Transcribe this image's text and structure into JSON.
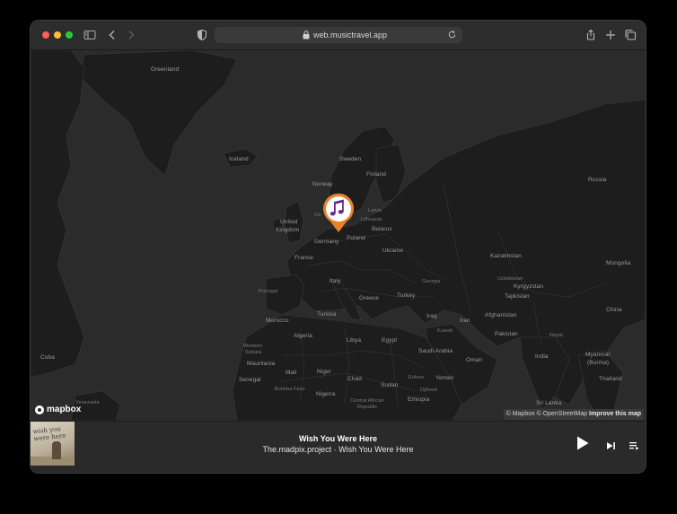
{
  "browser": {
    "url": "web.musictravel.app"
  },
  "map": {
    "countries": {
      "greenland": "Greenland",
      "iceland": "Iceland",
      "sweden": "Sweden",
      "finland": "Finland",
      "norway": "Norway",
      "russia": "Russia",
      "united_kingdom_1": "United",
      "united_kingdom_2": "Kingdom",
      "denmark": "De",
      "latvia": "Latvia",
      "lithuania": "Lithuania",
      "belarus": "Belarus",
      "poland": "Poland",
      "germany": "Germany",
      "ukraine": "Ukraine",
      "kazakhstan": "Kazakhstan",
      "mongolia": "Mongolia",
      "france": "France",
      "italy": "Italy",
      "portugal": "Portugal",
      "greece": "Greece",
      "turkey": "Turkey",
      "georgia": "Georgia",
      "uzbekistan": "Uzbekistan",
      "kyrgyzstan": "Kyrgyzstan",
      "tajikistan": "Tajikistan",
      "china": "China",
      "morocco": "Morocco",
      "tunisia": "Tunisia",
      "iraq": "Iraq",
      "iran": "Iran",
      "afghanistan": "Afghanistan",
      "pakistan": "Pakistan",
      "algeria": "Algeria",
      "libya": "Libya",
      "egypt": "Egypt",
      "kuwait": "Kuwait",
      "saudi_arabia": "Saudi Arabia",
      "nepal": "Nepal",
      "india": "India",
      "myanmar_1": "Myanmar",
      "myanmar_2": "(Burma)",
      "cuba": "Cuba",
      "western_sahara_1": "Western",
      "western_sahara_2": "Sahara",
      "mauritania": "Mauritania",
      "mali": "Mali",
      "niger": "Niger",
      "chad": "Chad",
      "sudan": "Sudan",
      "oman": "Oman",
      "yemen": "Yemen",
      "eritrea": "Eritrea",
      "djibouti": "Djibouti",
      "senegal": "Senegal",
      "burkina_faso": "Burkina Faso",
      "nigeria": "Nigeria",
      "ethiopia": "Ethiopia",
      "sri_lanka": "Sri Lanka",
      "thailand": "Thailand",
      "venezuela": "Venezuela",
      "central_african_republic_1": "Central African",
      "central_african_republic_2": "Republic"
    },
    "logo_text": "mapbox",
    "attribution": "© Mapbox © OpenStreetMap",
    "improve": "Improve this map",
    "pin_icon": "music-note-icon"
  },
  "player": {
    "title": "Wish You Were Here",
    "subtitle": "The.madpix.project · Wish You Were Here",
    "cover_text": "wish you were here"
  }
}
